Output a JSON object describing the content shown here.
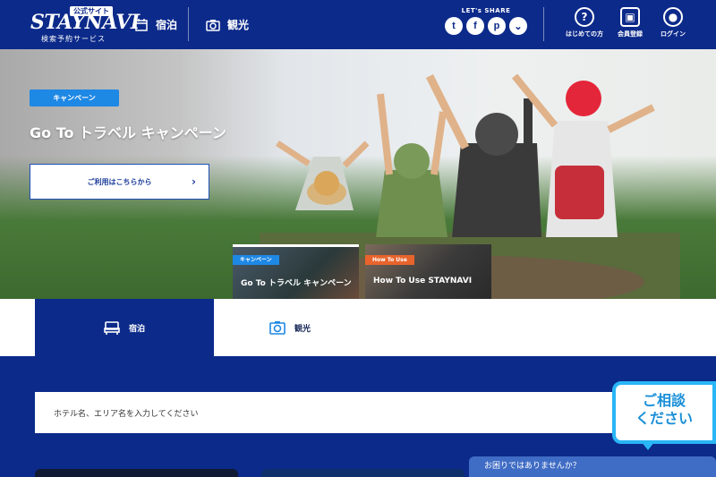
{
  "header": {
    "logo": {
      "badge": "公式サイト",
      "main_text": "STAYNAVI",
      "sub_text": "検索予約サービス"
    },
    "nav": [
      {
        "label": "宿泊",
        "icon": "calendar-icon"
      },
      {
        "label": "観光",
        "icon": "camera-icon"
      }
    ],
    "share": {
      "title": "LET's SHARE",
      "icons": [
        {
          "name": "twitter-icon",
          "glyph": "t"
        },
        {
          "name": "facebook-icon",
          "glyph": "f"
        },
        {
          "name": "pinterest-icon",
          "glyph": "p"
        },
        {
          "name": "pocket-icon",
          "glyph": "⌄"
        }
      ]
    },
    "utilities": [
      {
        "label": "はじめての方",
        "icon": "question-icon",
        "glyph": "?"
      },
      {
        "label": "会員登録",
        "icon": "member-card-icon",
        "glyph": "▣"
      },
      {
        "label": "ログイン",
        "icon": "user-icon",
        "glyph": "●"
      }
    ]
  },
  "hero": {
    "tag": "キャンペーン",
    "title": "Go To トラベル キャンペーン",
    "cta_label": "ご利用はこちらから",
    "thumbnails": [
      {
        "tag": "キャンペーン",
        "title": "Go To トラベル キャンペーン",
        "tag_color": "#1e88e5"
      },
      {
        "tag": "How To Use",
        "title": "How To Use STAYNAVI",
        "tag_color": "#e8642c"
      }
    ]
  },
  "tabs": [
    {
      "label": "宿泊",
      "icon": "bed-icon",
      "active": true
    },
    {
      "label": "観光",
      "icon": "camera-icon",
      "active": false
    }
  ],
  "search": {
    "placeholder": "ホテル名、エリア名を入力してください"
  },
  "chat": {
    "bubble_line1": "ご相談",
    "bubble_line2": "ください",
    "bar_text": "お困りではありませんか？"
  },
  "colors": {
    "brand_navy": "#0c2a8a",
    "accent_blue": "#1e88e5",
    "orange": "#e8642c",
    "chat_cyan": "#29b6f6"
  }
}
